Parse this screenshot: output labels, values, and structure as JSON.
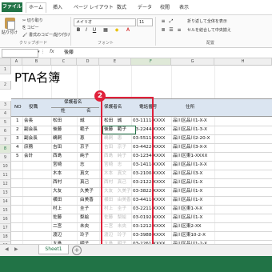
{
  "ribbon_tabs": [
    "ファイル",
    "ホーム",
    "挿入",
    "ページ レイアウト",
    "数式",
    "データ",
    "校閲",
    "表示"
  ],
  "clipboard": {
    "paste_label": "貼り付け",
    "cut": "切り取り",
    "copy": "コピー",
    "format_painter": "書式のコピー/貼り付け",
    "group": "クリップボード"
  },
  "font": {
    "name": "メイリオ",
    "size": "11",
    "group": "フォント"
  },
  "alignment": {
    "wrap": "折り返して全体を表示",
    "merge": "セルを結合して中央揃え",
    "group": "配置"
  },
  "formula_bar": {
    "name_box": "",
    "fx": "fx",
    "value": "後藤"
  },
  "columns": [
    "A",
    "B",
    "C",
    "D",
    "E",
    "F",
    "G",
    "H"
  ],
  "rows": [
    "1",
    "2",
    "3",
    "4",
    "5",
    "6",
    "7",
    "8",
    "9",
    "10",
    "11",
    "12",
    "13",
    "14",
    "15",
    "16",
    "17",
    "18",
    "19",
    "20"
  ],
  "sheet": {
    "title": "PTA名簿",
    "header": {
      "no": "NO",
      "role": "役職",
      "guardian_group": "保護者名",
      "last": "姓",
      "first": "名",
      "guardian_name": "保護者名",
      "phone": "電話番号",
      "address": "住所"
    },
    "records": [
      {
        "no": "1",
        "role": "会長",
        "last": "松田",
        "first": "誠",
        "guardian": "松田　誠",
        "phone": "03-1111-XXXX",
        "address": "品川区品川1-X-X"
      },
      {
        "no": "2",
        "role": "副会長",
        "last": "後藤",
        "first": "範子",
        "guardian": "後藤　範子",
        "phone": "03-2244-XXXX",
        "address": "品川区品川1-3-X"
      },
      {
        "no": "3",
        "role": "副会長",
        "last": "鵜飼",
        "first": "恵",
        "guardian": "鵜飼　恵",
        "phone": "03-5511-XXXX",
        "address": "品川区品川2-20-X"
      },
      {
        "no": "4",
        "role": "庶務",
        "last": "吉田",
        "first": "京子",
        "guardian": "吉田　京子",
        "phone": "03-4422-XXXX",
        "address": "品川区品川3-X-X"
      },
      {
        "no": "5",
        "role": "会計",
        "last": "西島",
        "first": "純子",
        "guardian": "西島　純子",
        "phone": "03-1234-XXXX",
        "address": "品川区東1-XXXX"
      },
      {
        "no": "",
        "role": "",
        "last": "宮崎",
        "first": "志",
        "guardian": "宮崎　志",
        "phone": "03-1411-XXXX",
        "address": "品川区品川1-X-X"
      },
      {
        "no": "",
        "role": "",
        "last": "木本",
        "first": "真文",
        "guardian": "木本　真文",
        "phone": "03-2100-XXXX",
        "address": "品川区品川3-X"
      },
      {
        "no": "",
        "role": "",
        "last": "西村",
        "first": "真己",
        "guardian": "西村　真己",
        "phone": "03-2122-XXXX",
        "address": "品川区品川1-X"
      },
      {
        "no": "",
        "role": "",
        "last": "大友",
        "first": "久美子",
        "guardian": "大友　久美子",
        "phone": "03-3822-XXXX",
        "address": "品川区品川1-X"
      },
      {
        "no": "",
        "role": "",
        "last": "横田",
        "first": "由美香",
        "guardian": "横田　由美香",
        "phone": "03-4411-XXXX",
        "address": "品川区品川1-X"
      },
      {
        "no": "",
        "role": "",
        "last": "村上",
        "first": "圭子",
        "guardian": "村上　圭子",
        "phone": "03-2211-XXXX",
        "address": "品川区東1-X-X"
      },
      {
        "no": "",
        "role": "",
        "last": "佐藤",
        "first": "梨絵",
        "guardian": "佐藤　梨絵",
        "phone": "03-0192-XXXX",
        "address": "品川区品川1-X"
      },
      {
        "no": "",
        "role": "",
        "last": "二宮",
        "first": "未央",
        "guardian": "二宮　未央",
        "phone": "03-1212-XXXX",
        "address": "品川区東2-XX"
      },
      {
        "no": "",
        "role": "",
        "last": "渡辺",
        "first": "玲子",
        "guardian": "渡辺　玲子",
        "phone": "03-3988-XXXX",
        "address": "品川区東10-2-X"
      },
      {
        "no": "",
        "role": "",
        "last": "大島",
        "first": "明子",
        "guardian": "大島　明子",
        "phone": "03-2261-XXXX",
        "address": "品川区品川1-2-X"
      }
    ]
  },
  "callout": {
    "number": "2"
  },
  "sheet_tabs": [
    "Sheet1"
  ],
  "colors": {
    "excel_green": "#217346",
    "header_band": "#dbe5f1",
    "callout_red": "#e0203a"
  }
}
